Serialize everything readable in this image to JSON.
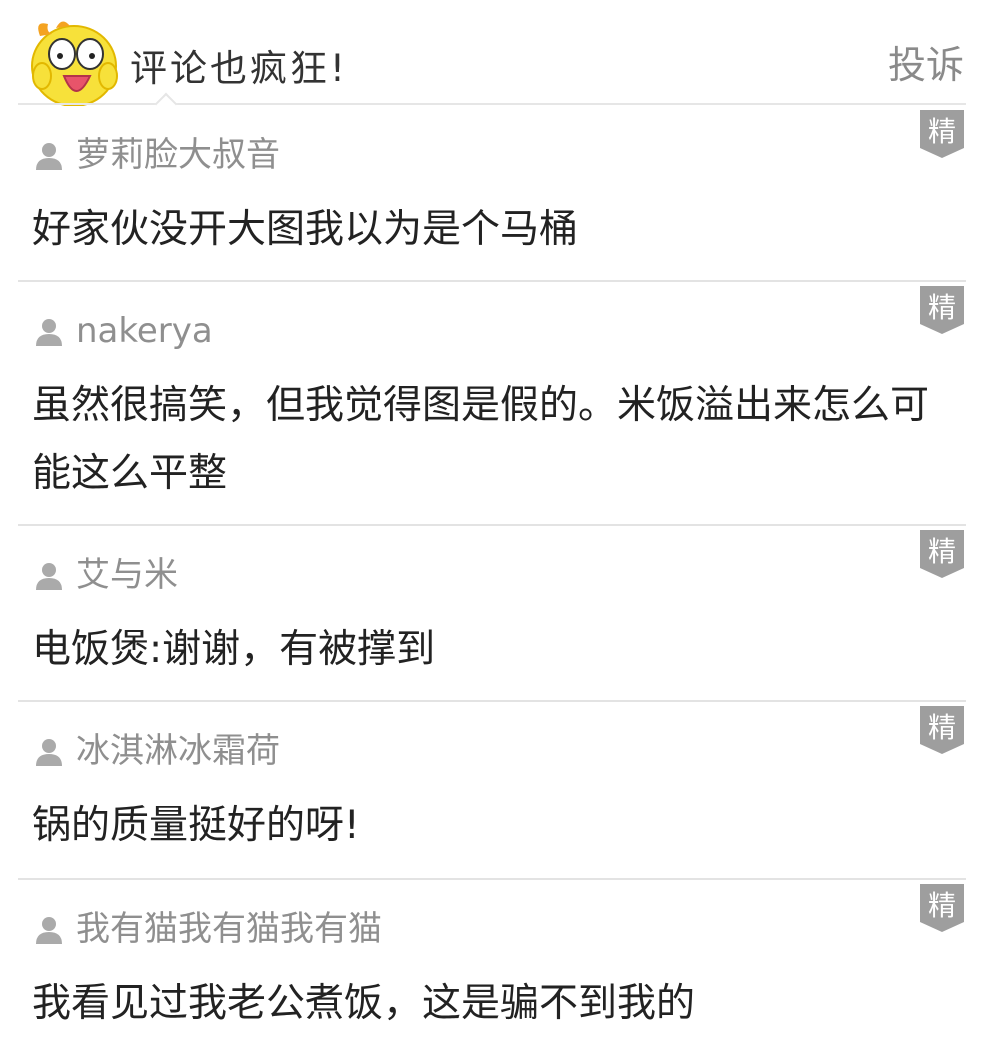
{
  "header": {
    "title": "评论也疯狂!",
    "report_label": "投诉"
  },
  "badge_label": "精",
  "comments": [
    {
      "username": "萝莉脸大叔音",
      "text": "好家伙没开大图我以为是个马桶"
    },
    {
      "username": "nakerya",
      "text": "虽然很搞笑，但我觉得图是假的。米饭溢出来怎么可能这么平整"
    },
    {
      "username": "艾与米",
      "text": "电饭煲:谢谢，有被撑到"
    },
    {
      "username": "冰淇淋冰霜荷",
      "text": "锅的质量挺好的呀!"
    },
    {
      "username": "我有猫我有猫我有猫",
      "text": "我看见过我老公煮饭，这是骗不到我的"
    }
  ],
  "colors": {
    "badge_bg": "#9e9e9e",
    "username": "#8f8f8f",
    "text": "#222222",
    "mascot_yellow": "#f7e13a"
  }
}
